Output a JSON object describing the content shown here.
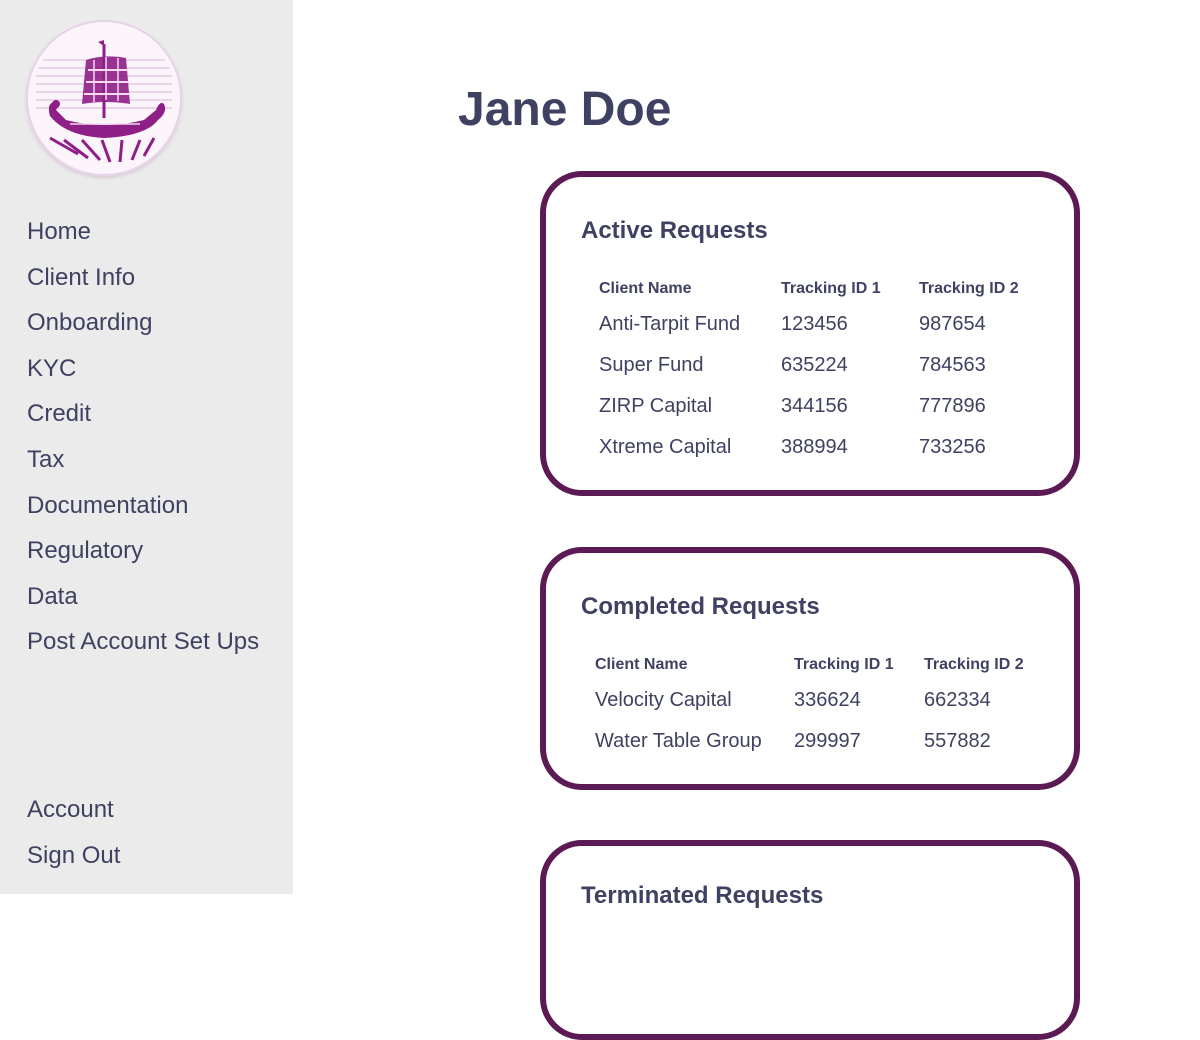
{
  "colors": {
    "sidebar_bg": "#ebebeb",
    "text": "#3e4161",
    "card_border": "#5c1a55",
    "logo_purple": "#8e1f86"
  },
  "logo": {
    "icon": "viking-ship-icon"
  },
  "sidebar": {
    "items": [
      {
        "label": "Home"
      },
      {
        "label": "Client Info"
      },
      {
        "label": "Onboarding"
      },
      {
        "label": "KYC"
      },
      {
        "label": "Credit"
      },
      {
        "label": "Tax"
      },
      {
        "label": "Documentation"
      },
      {
        "label": "Regulatory"
      },
      {
        "label": "Data"
      },
      {
        "label": "Post Account Set Ups"
      }
    ],
    "bottom_items": [
      {
        "label": "Account"
      },
      {
        "label": "Sign Out"
      }
    ]
  },
  "main": {
    "title": "Jane Doe",
    "active": {
      "title": "Active Requests",
      "headers": [
        "Client Name",
        "Tracking ID 1",
        "Tracking ID 2"
      ],
      "rows": [
        [
          "Anti-Tarpit Fund",
          "123456",
          "987654"
        ],
        [
          "Super Fund",
          "635224",
          "784563"
        ],
        [
          "ZIRP Capital",
          "344156",
          "777896"
        ],
        [
          "Xtreme Capital",
          "388994",
          "733256"
        ]
      ]
    },
    "completed": {
      "title": "Completed Requests",
      "headers": [
        "Client Name",
        "Tracking ID 1",
        "Tracking ID 2"
      ],
      "rows": [
        [
          "Velocity Capital",
          "336624",
          "662334"
        ],
        [
          "Water Table Group",
          "299997",
          "557882"
        ]
      ]
    },
    "terminated": {
      "title": "Terminated Requests"
    }
  }
}
